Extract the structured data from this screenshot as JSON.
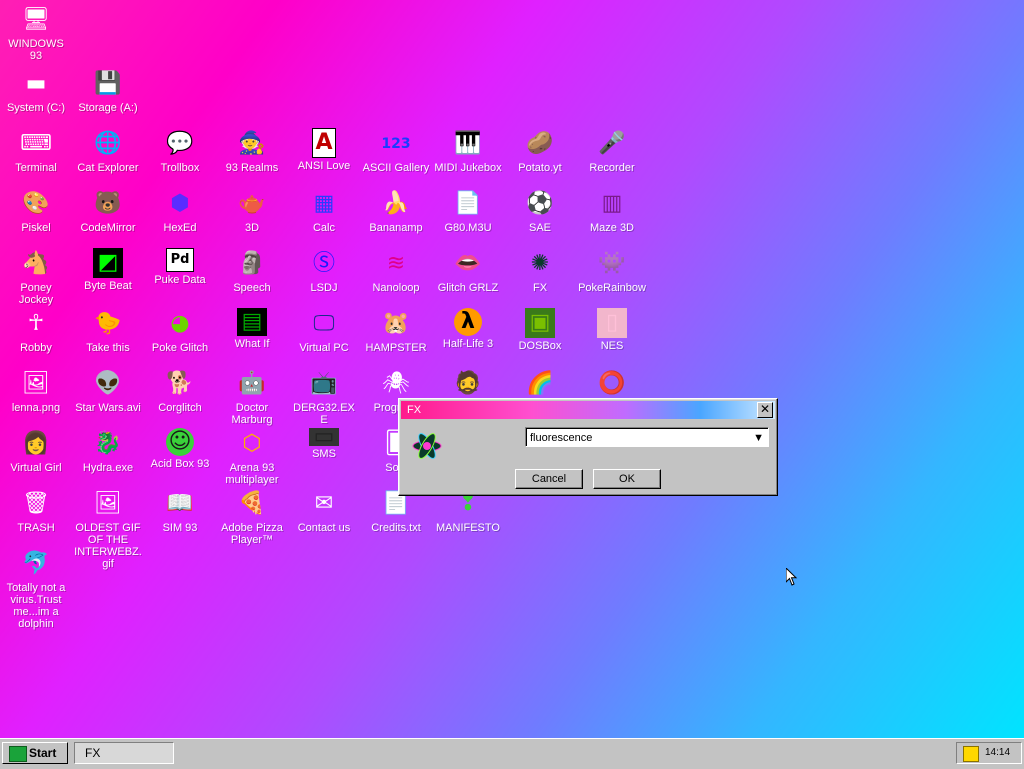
{
  "desktop": {
    "icons": [
      {
        "label": "WINDOWS 93",
        "glyph": "🖥"
      },
      {
        "label": "System (C:)",
        "glyph": "▬"
      },
      {
        "label": "Storage (A:)",
        "glyph": "💾"
      },
      {
        "label": "Terminal",
        "glyph": "⌨"
      },
      {
        "label": "Cat Explorer",
        "glyph": "🌐"
      },
      {
        "label": "Trollbox",
        "glyph": "💬"
      },
      {
        "label": "93 Realms",
        "glyph": "🧙"
      },
      {
        "label": "ANSI Love",
        "glyph": "A"
      },
      {
        "label": "ASCII Gallery",
        "glyph": "123"
      },
      {
        "label": "MIDI Jukebox",
        "glyph": "🎹"
      },
      {
        "label": "Potato.yt",
        "glyph": "🥔"
      },
      {
        "label": "Recorder",
        "glyph": "🎤"
      },
      {
        "label": "Piskel",
        "glyph": "🎨"
      },
      {
        "label": "CodeMirror",
        "glyph": "🐻"
      },
      {
        "label": "HexEd",
        "glyph": "⬢"
      },
      {
        "label": "3D",
        "glyph": "🫖"
      },
      {
        "label": "Calc",
        "glyph": "▦"
      },
      {
        "label": "Bananamp",
        "glyph": "🍌"
      },
      {
        "label": "G80.M3U",
        "glyph": "📄"
      },
      {
        "label": "SAE",
        "glyph": "⚽"
      },
      {
        "label": "Maze 3D",
        "glyph": "▥"
      },
      {
        "label": "Poney Jockey",
        "glyph": "🐴"
      },
      {
        "label": "Byte Beat",
        "glyph": "◩"
      },
      {
        "label": "Puke Data",
        "glyph": "Pd"
      },
      {
        "label": "Speech",
        "glyph": "🗿"
      },
      {
        "label": "LSDJ",
        "glyph": "Ⓢ"
      },
      {
        "label": "Nanoloop",
        "glyph": "≋"
      },
      {
        "label": "Glitch GRLZ",
        "glyph": "👄"
      },
      {
        "label": "FX",
        "glyph": "✺"
      },
      {
        "label": "PokeRainbow",
        "glyph": "👾"
      },
      {
        "label": "Robby",
        "glyph": "☥"
      },
      {
        "label": "Take this",
        "glyph": "🐤"
      },
      {
        "label": "Poke Glitch",
        "glyph": "◕"
      },
      {
        "label": "What If",
        "glyph": "▤"
      },
      {
        "label": "Virtual PC",
        "glyph": "🖵"
      },
      {
        "label": "HAMPSTER",
        "glyph": "🐹"
      },
      {
        "label": "Half-Life 3",
        "glyph": "λ"
      },
      {
        "label": "DOSBox",
        "glyph": "▣"
      },
      {
        "label": "NES",
        "glyph": "▯"
      },
      {
        "label": "lenna.png",
        "glyph": "🖼"
      },
      {
        "label": "Star Wars.avi",
        "glyph": "👽"
      },
      {
        "label": "Corglitch",
        "glyph": "🐕"
      },
      {
        "label": "Doctor Marburg",
        "glyph": "🤖"
      },
      {
        "label": "DERG32.EXE",
        "glyph": "📺"
      },
      {
        "label": "Progr Qu",
        "glyph": "🕷"
      },
      {
        "label": "",
        "glyph": "🧔"
      },
      {
        "label": "",
        "glyph": "🌈"
      },
      {
        "label": "",
        "glyph": "⭕"
      },
      {
        "label": "Virtual Girl",
        "glyph": "👩"
      },
      {
        "label": "Hydra.exe",
        "glyph": "🐉"
      },
      {
        "label": "Acid Box 93",
        "glyph": "☺"
      },
      {
        "label": "Arena 93 multiplayer",
        "glyph": "⬡"
      },
      {
        "label": "SMS",
        "glyph": "▭"
      },
      {
        "label": "Solit",
        "glyph": "🂠"
      },
      {
        "label": "TRASH",
        "glyph": "🗑"
      },
      {
        "label": "OLDEST GIF OF THE INTERWEBZ.gif",
        "glyph": "🖼"
      },
      {
        "label": "SIM 93",
        "glyph": "📖"
      },
      {
        "label": "Adobe Pizza Player™",
        "glyph": "🍕"
      },
      {
        "label": "Contact us",
        "glyph": "✉"
      },
      {
        "label": "Credits.txt",
        "glyph": "📄"
      },
      {
        "label": "MANIFESTO",
        "glyph": "❢"
      },
      {
        "label": "Totally not a virus.Trust me...im a dolphin",
        "glyph": "🐬"
      }
    ]
  },
  "dialog": {
    "title": "FX",
    "close_glyph": "✕",
    "select_value": "fluorescence",
    "select_arrow": "▼",
    "cancel_label": "Cancel",
    "ok_label": "OK",
    "title_gradient": [
      "#ff1a8c",
      "#c06bff",
      "#cfe9ff"
    ]
  },
  "taskbar": {
    "start_label": "Start",
    "tasks": [
      {
        "label": "FX"
      }
    ],
    "clock": "14:14"
  },
  "colors": {
    "desktop_gradient": [
      "#ff1fb4",
      "#e020ff",
      "#6f7cff",
      "#00e4ff"
    ],
    "chrome": "#c3c3c3"
  }
}
